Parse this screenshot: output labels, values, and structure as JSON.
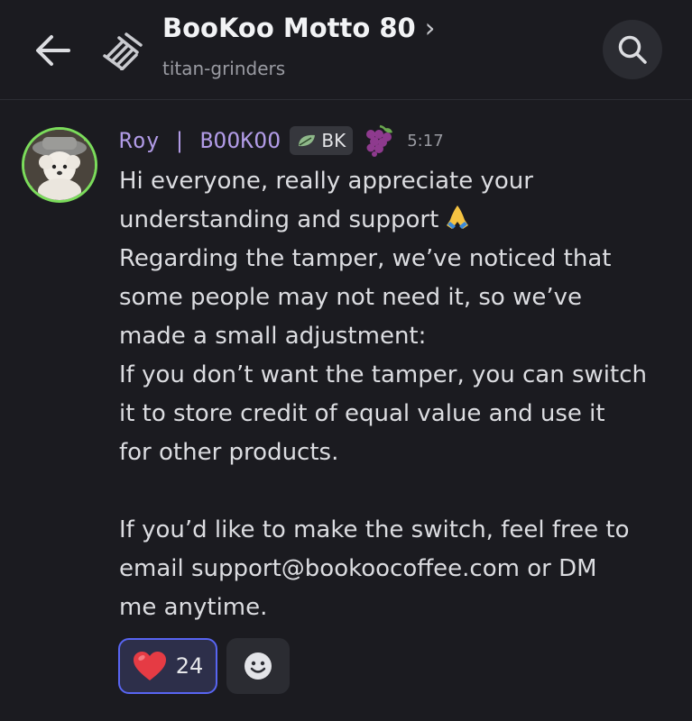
{
  "header": {
    "title": "BooKoo Motto 80",
    "title_chevron": "›",
    "subtitle": "titan-grinders"
  },
  "message": {
    "username": "Roy | BOOKOO",
    "tag": "BK",
    "timestamp": "5:17",
    "lines": [
      "Hi everyone, really appreciate your",
      "understanding and support",
      "Regarding the tamper, we’ve noticed that",
      "some people may not need it, so we’ve",
      "made a small adjustment:",
      "If you don’t want the tamper, you can switch",
      "it to store credit of equal value and use it",
      "for other products.",
      "If you’d like to make the switch, feel free to",
      "email support@bookoocoffee.com or DM",
      "me anytime."
    ]
  },
  "reactions": [
    {
      "emoji": "heart-emoji",
      "count": "24"
    }
  ],
  "icons": {
    "back": "arrow-left-icon",
    "channel": "forum-channel-icon",
    "search": "search-icon",
    "add_reaction": "smiley-icon"
  },
  "colors": {
    "background": "#1b1b20",
    "username": "#b19be6",
    "reaction_border": "#5865f2",
    "avatar_ring": "#7bdc5b"
  }
}
